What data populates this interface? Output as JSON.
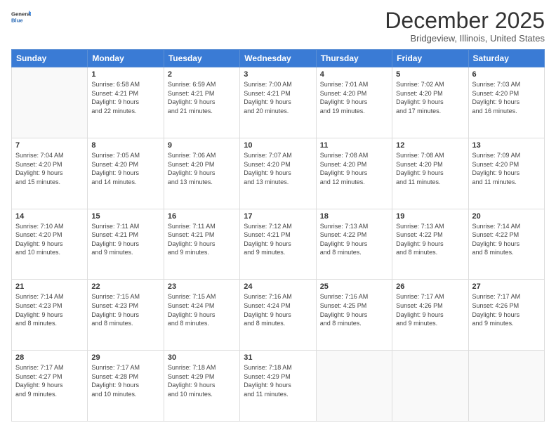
{
  "header": {
    "logo_line1": "General",
    "logo_line2": "Blue",
    "month_title": "December 2025",
    "location": "Bridgeview, Illinois, United States"
  },
  "days_of_week": [
    "Sunday",
    "Monday",
    "Tuesday",
    "Wednesday",
    "Thursday",
    "Friday",
    "Saturday"
  ],
  "weeks": [
    [
      {
        "num": "",
        "info": ""
      },
      {
        "num": "1",
        "info": "Sunrise: 6:58 AM\nSunset: 4:21 PM\nDaylight: 9 hours\nand 22 minutes."
      },
      {
        "num": "2",
        "info": "Sunrise: 6:59 AM\nSunset: 4:21 PM\nDaylight: 9 hours\nand 21 minutes."
      },
      {
        "num": "3",
        "info": "Sunrise: 7:00 AM\nSunset: 4:21 PM\nDaylight: 9 hours\nand 20 minutes."
      },
      {
        "num": "4",
        "info": "Sunrise: 7:01 AM\nSunset: 4:20 PM\nDaylight: 9 hours\nand 19 minutes."
      },
      {
        "num": "5",
        "info": "Sunrise: 7:02 AM\nSunset: 4:20 PM\nDaylight: 9 hours\nand 17 minutes."
      },
      {
        "num": "6",
        "info": "Sunrise: 7:03 AM\nSunset: 4:20 PM\nDaylight: 9 hours\nand 16 minutes."
      }
    ],
    [
      {
        "num": "7",
        "info": "Sunrise: 7:04 AM\nSunset: 4:20 PM\nDaylight: 9 hours\nand 15 minutes."
      },
      {
        "num": "8",
        "info": "Sunrise: 7:05 AM\nSunset: 4:20 PM\nDaylight: 9 hours\nand 14 minutes."
      },
      {
        "num": "9",
        "info": "Sunrise: 7:06 AM\nSunset: 4:20 PM\nDaylight: 9 hours\nand 13 minutes."
      },
      {
        "num": "10",
        "info": "Sunrise: 7:07 AM\nSunset: 4:20 PM\nDaylight: 9 hours\nand 13 minutes."
      },
      {
        "num": "11",
        "info": "Sunrise: 7:08 AM\nSunset: 4:20 PM\nDaylight: 9 hours\nand 12 minutes."
      },
      {
        "num": "12",
        "info": "Sunrise: 7:08 AM\nSunset: 4:20 PM\nDaylight: 9 hours\nand 11 minutes."
      },
      {
        "num": "13",
        "info": "Sunrise: 7:09 AM\nSunset: 4:20 PM\nDaylight: 9 hours\nand 11 minutes."
      }
    ],
    [
      {
        "num": "14",
        "info": "Sunrise: 7:10 AM\nSunset: 4:20 PM\nDaylight: 9 hours\nand 10 minutes."
      },
      {
        "num": "15",
        "info": "Sunrise: 7:11 AM\nSunset: 4:21 PM\nDaylight: 9 hours\nand 9 minutes."
      },
      {
        "num": "16",
        "info": "Sunrise: 7:11 AM\nSunset: 4:21 PM\nDaylight: 9 hours\nand 9 minutes."
      },
      {
        "num": "17",
        "info": "Sunrise: 7:12 AM\nSunset: 4:21 PM\nDaylight: 9 hours\nand 9 minutes."
      },
      {
        "num": "18",
        "info": "Sunrise: 7:13 AM\nSunset: 4:22 PM\nDaylight: 9 hours\nand 8 minutes."
      },
      {
        "num": "19",
        "info": "Sunrise: 7:13 AM\nSunset: 4:22 PM\nDaylight: 9 hours\nand 8 minutes."
      },
      {
        "num": "20",
        "info": "Sunrise: 7:14 AM\nSunset: 4:22 PM\nDaylight: 9 hours\nand 8 minutes."
      }
    ],
    [
      {
        "num": "21",
        "info": "Sunrise: 7:14 AM\nSunset: 4:23 PM\nDaylight: 9 hours\nand 8 minutes."
      },
      {
        "num": "22",
        "info": "Sunrise: 7:15 AM\nSunset: 4:23 PM\nDaylight: 9 hours\nand 8 minutes."
      },
      {
        "num": "23",
        "info": "Sunrise: 7:15 AM\nSunset: 4:24 PM\nDaylight: 9 hours\nand 8 minutes."
      },
      {
        "num": "24",
        "info": "Sunrise: 7:16 AM\nSunset: 4:24 PM\nDaylight: 9 hours\nand 8 minutes."
      },
      {
        "num": "25",
        "info": "Sunrise: 7:16 AM\nSunset: 4:25 PM\nDaylight: 9 hours\nand 8 minutes."
      },
      {
        "num": "26",
        "info": "Sunrise: 7:17 AM\nSunset: 4:26 PM\nDaylight: 9 hours\nand 9 minutes."
      },
      {
        "num": "27",
        "info": "Sunrise: 7:17 AM\nSunset: 4:26 PM\nDaylight: 9 hours\nand 9 minutes."
      }
    ],
    [
      {
        "num": "28",
        "info": "Sunrise: 7:17 AM\nSunset: 4:27 PM\nDaylight: 9 hours\nand 9 minutes."
      },
      {
        "num": "29",
        "info": "Sunrise: 7:17 AM\nSunset: 4:28 PM\nDaylight: 9 hours\nand 10 minutes."
      },
      {
        "num": "30",
        "info": "Sunrise: 7:18 AM\nSunset: 4:29 PM\nDaylight: 9 hours\nand 10 minutes."
      },
      {
        "num": "31",
        "info": "Sunrise: 7:18 AM\nSunset: 4:29 PM\nDaylight: 9 hours\nand 11 minutes."
      },
      {
        "num": "",
        "info": ""
      },
      {
        "num": "",
        "info": ""
      },
      {
        "num": "",
        "info": ""
      }
    ]
  ]
}
